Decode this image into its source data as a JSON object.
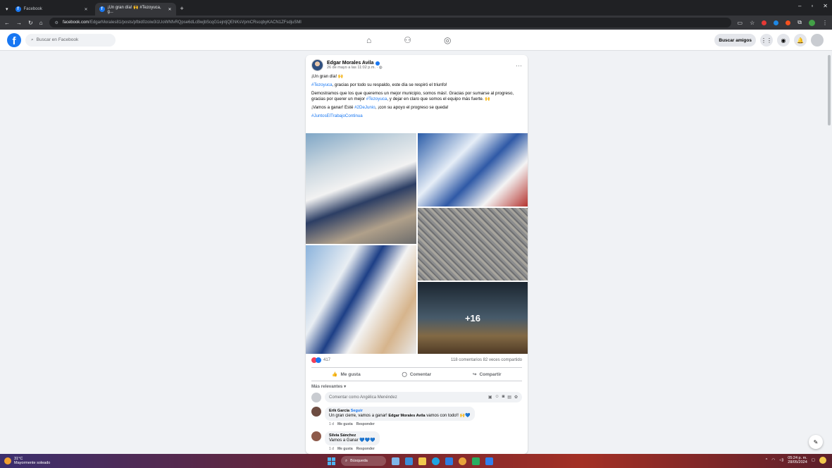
{
  "browser": {
    "tabs": [
      {
        "title": "Facebook",
        "active": false
      },
      {
        "title": "¡Un gran día! 🙌 #Tezoyuca, g...",
        "active": true
      }
    ],
    "new_tab": "+",
    "url_host": "facebook.com",
    "url_path": "/EdgarMorales81/posts/pfbid0zoiw3i1UoWNfvRQpse6dLcBwjbScqG1ejntjQENKsVpmCRscqbyKACN1ZFsdjuSMl"
  },
  "facebook": {
    "search_placeholder": "Buscar en Facebook",
    "find_friends": "Buscar amigos"
  },
  "post": {
    "author": "Edgar Morales Avila",
    "timestamp": "26 de mayo a las 11:02 p.m. · ",
    "line1": "¡Un gran día! 🙌",
    "line2_tag": "#Tezoyuca",
    "line2_rest": ", gracias por todo su respaldo, este día se respiró el triunfo!",
    "line3a": "Demostramos que los que queremos un mejor municipio, somos más!. Gracias por sumarse al progreso, gracias por querer un mejor ",
    "line3_tag": "#Tezoyuca",
    "line3b": ", y dejar en claro que somos el equipo más fuerte. 🙌",
    "line4a": "¡Vamos a ganar! Esté ",
    "line4_tag": "#2DeJunio",
    "line4b": ", ¡con su apoyo el progreso se queda!",
    "line5_tag": "#JuntosElTrabajoContinua",
    "more_photos": "+16",
    "reactions_count": "417",
    "comments_shares": "118 comentarios  82 veces compartido",
    "like": "Me gusta",
    "comment": "Comentar",
    "share": "Compartir",
    "sort_label": "Más relevantes ▾",
    "comment_placeholder": "Comentar como Angélica Menéndez"
  },
  "comments": [
    {
      "name": "Erik Garcia",
      "follow": "Seguir",
      "text_a": "Un gran cierre, vamos a ganar! ",
      "mention": "Edgar Morales Avila",
      "text_b": " vamos con todo!! 🙌💙",
      "time": "1 d",
      "like": "Me gusta",
      "reply": "Responder"
    },
    {
      "name": "Silvia Sánchez",
      "text_a": "Vamos a Ganar 💙💙💙",
      "time": "1 d",
      "like": "Me gusta",
      "reply": "Responder"
    }
  ],
  "taskbar": {
    "temp": "31°C",
    "weather": "Mayormente soleado",
    "search": "Búsqueda",
    "time": "05:24 p. m.",
    "date": "28/05/2024"
  },
  "colors": {
    "fb_blue": "#1877f2",
    "chrome_dark": "#202124"
  }
}
